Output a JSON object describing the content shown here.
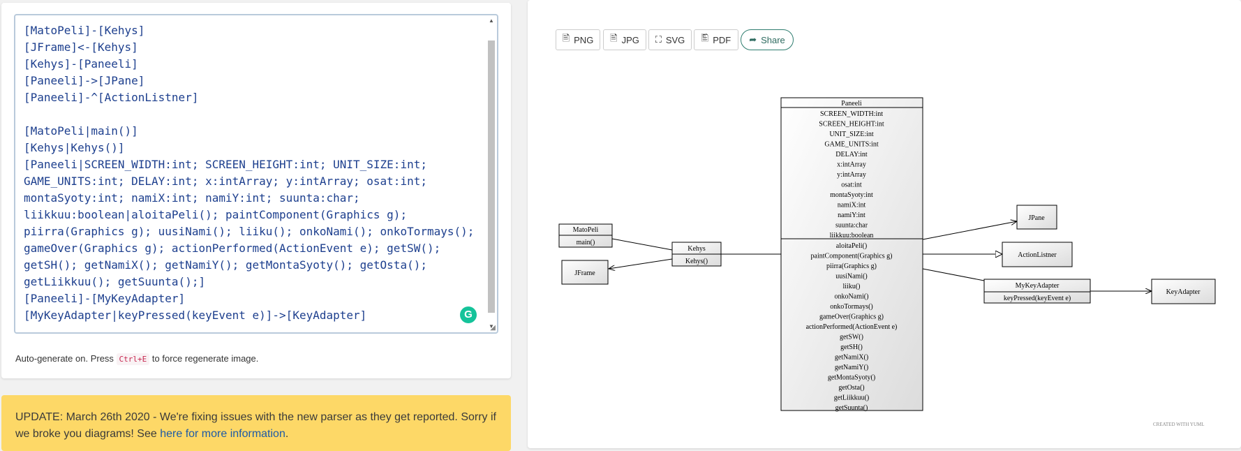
{
  "editor": {
    "code": "[MatoPeli]-[Kehys]\n[JFrame]<-[Kehys]\n[Kehys]-[Paneeli]\n[Paneeli]->[JPane]\n[Paneeli]-^[ActionListner]\n\n[MatoPeli|main()]\n[Kehys|Kehys()]\n[Paneeli|SCREEN_WIDTH:int; SCREEN_HEIGHT:int; UNIT_SIZE:int;\nGAME_UNITS:int; DELAY:int; x:intArray; y:intArray; osat:int;\nmontaSyoty:int; namiX:int; namiY:int; suunta:char;\nliikkuu:boolean|aloitaPeli(); paintComponent(Graphics g);\npiirra(Graphics g); uusiNami(); liiku(); onkoNami(); onkoTormays();\ngameOver(Graphics g); actionPerformed(ActionEvent e); getSW();\ngetSH(); getNamiX(); getNamiY(); getMontaSyoty(); getOsta();\ngetLiikkuu(); getSuunta();]\n[Paneeli]-[MyKeyAdapter]\n[MyKeyAdapter|keyPressed(keyEvent e)]->[KeyAdapter]"
  },
  "hint": {
    "before": "Auto-generate on. Press ",
    "shortcut": "Ctrl+E",
    "after": " to force regenerate image."
  },
  "update": {
    "text": "UPDATE: March 26th 2020 - We're fixing issues with the new parser as they get reported. Sorry if we broke you diagrams! See ",
    "link": "here for more information",
    "after": "."
  },
  "toolbar": {
    "png": "PNG",
    "jpg": "JPG",
    "svg": "SVG",
    "pdf": "PDF",
    "share": "Share"
  },
  "diagram": {
    "classes": {
      "matopeli": {
        "name": "MatoPeli",
        "members": [
          "main()"
        ]
      },
      "jframe": {
        "name": "JFrame"
      },
      "kehys": {
        "name": "Kehys",
        "members": [
          "Kehys()"
        ]
      },
      "paneeli": {
        "name": "Paneeli",
        "attributes": [
          "SCREEN_WIDTH:int",
          "SCREEN_HEIGHT:int",
          "UNIT_SIZE:int",
          "GAME_UNITS:int",
          "DELAY:int",
          "x:intArray",
          "y:intArray",
          "osat:int",
          "montaSyoty:int",
          "namiX:int",
          "namiY:int",
          "suunta:char",
          "liikkuu:boolean"
        ],
        "methods": [
          "aloitaPeli()",
          "paintComponent(Graphics g)",
          "piirra(Graphics g)",
          "uusiNami()",
          "liiku()",
          "onkoNami()",
          "onkoTormays()",
          "gameOver(Graphics g)",
          "actionPerformed(ActionEvent e)",
          "getSW()",
          "getSH()",
          "getNamiX()",
          "getNamiY()",
          "getMontaSyoty()",
          "getOsta()",
          "getLiikkuu()",
          "getSuunta()"
        ]
      },
      "jpane": {
        "name": "JPane"
      },
      "actionlistner": {
        "name": "ActionListner"
      },
      "mykeyadapter": {
        "name": "MyKeyAdapter",
        "members": [
          "keyPressed(keyEvent e)"
        ]
      },
      "keyadapter": {
        "name": "KeyAdapter"
      }
    }
  },
  "credit": "CREATED WITH YUML",
  "colors": {
    "accent": "#2e7d6f",
    "code": "#1d3f8e",
    "banner": "#fdd867",
    "grammarly": "#15c39a"
  },
  "icons": [
    "file-image-icon",
    "file-svg-icon",
    "file-pdf-icon",
    "share-arrow-icon",
    "grammarly-icon"
  ]
}
